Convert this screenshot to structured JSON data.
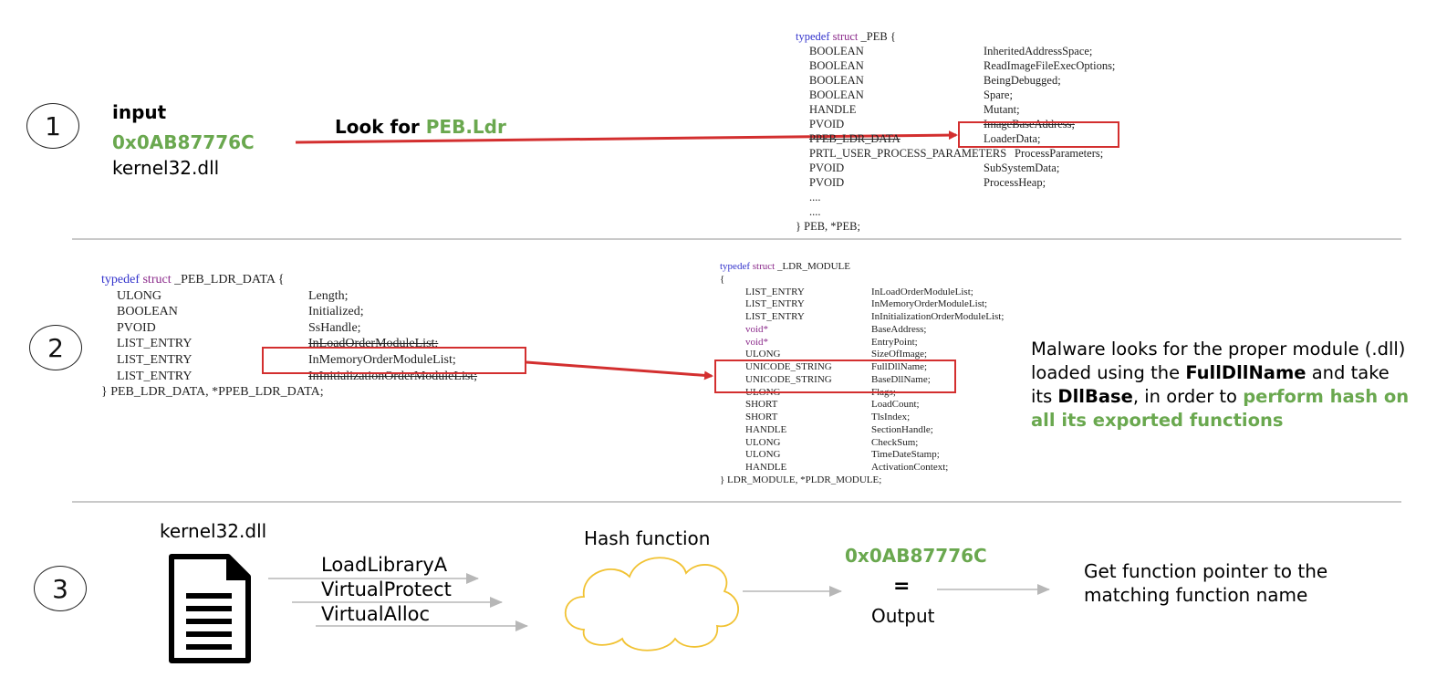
{
  "steps": [
    "1",
    "2",
    "3"
  ],
  "row1": {
    "input_label": "input",
    "input_hash": "0x0AB87776C",
    "input_dll": "kernel32.dll",
    "look_prefix": "Look for ",
    "look_target": "PEB.Ldr"
  },
  "peb": {
    "header": {
      "kw1": "typedef",
      "kw2": "struct",
      "name": "_PEB {"
    },
    "fields": [
      {
        "type": "BOOLEAN",
        "name": "InheritedAddressSpace;"
      },
      {
        "type": "BOOLEAN",
        "name": "ReadImageFileExecOptions;"
      },
      {
        "type": "BOOLEAN",
        "name": "BeingDebugged;"
      },
      {
        "type": "BOOLEAN",
        "name": "Spare;"
      },
      {
        "type": "HANDLE",
        "name": "Mutant;"
      },
      {
        "type": "PVOID",
        "name": "ImageBaseAddress;"
      },
      {
        "type": "PPEB_LDR_DATA",
        "name": "LoaderData;"
      },
      {
        "type": "PRTL_USER_PROCESS_PARAMETERS",
        "name": "ProcessParameters;"
      },
      {
        "type": "PVOID",
        "name": "SubSystemData;"
      },
      {
        "type": "PVOID",
        "name": "ProcessHeap;"
      },
      {
        "type": "....",
        "name": ""
      },
      {
        "type": "....",
        "name": ""
      }
    ],
    "footer": "} PEB, *PEB;"
  },
  "ldr_data": {
    "header": {
      "kw1": "typedef",
      "kw2": "struct",
      "name": "_PEB_LDR_DATA {"
    },
    "fields": [
      {
        "type": "ULONG",
        "name": "Length;"
      },
      {
        "type": "BOOLEAN",
        "name": "Initialized;"
      },
      {
        "type": "PVOID",
        "name": "SsHandle;"
      },
      {
        "type": "LIST_ENTRY",
        "name": "InLoadOrderModuleList;"
      },
      {
        "type": "LIST_ENTRY",
        "name": "InMemoryOrderModuleList;"
      },
      {
        "type": "LIST_ENTRY",
        "name": "InInitializationOrderModuleList;"
      }
    ],
    "footer": "} PEB_LDR_DATA, *PPEB_LDR_DATA;"
  },
  "ldr_module": {
    "header": {
      "kw1": "typedef",
      "kw2": "struct",
      "name": "_LDR_MODULE"
    },
    "brace_open": "{",
    "fields": [
      {
        "type": "LIST_ENTRY",
        "name": "InLoadOrderModuleList;"
      },
      {
        "type": "LIST_ENTRY",
        "name": "InMemoryOrderModuleList;"
      },
      {
        "type": "LIST_ENTRY",
        "name": "InInitializationOrderModuleList;"
      },
      {
        "type": "void*",
        "name": "BaseAddress;"
      },
      {
        "type": "void*",
        "name": "EntryPoint;"
      },
      {
        "type": "ULONG",
        "name": "SizeOfImage;"
      },
      {
        "type": "UNICODE_STRING",
        "name": "FullDllName;"
      },
      {
        "type": "UNICODE_STRING",
        "name": "BaseDllName;"
      },
      {
        "type": "ULONG",
        "name": "Flags;"
      },
      {
        "type": "SHORT",
        "name": "LoadCount;"
      },
      {
        "type": "SHORT",
        "name": "TlsIndex;"
      },
      {
        "type": "HANDLE",
        "name": "SectionHandle;"
      },
      {
        "type": "ULONG",
        "name": "CheckSum;"
      },
      {
        "type": "ULONG",
        "name": "TimeDateStamp;"
      },
      {
        "type": "HANDLE",
        "name": "ActivationContext;"
      }
    ],
    "footer": "} LDR_MODULE, *PLDR_MODULE;"
  },
  "row2": {
    "desc": {
      "t1": "Malware looks for the proper module (.dll) loaded using the ",
      "b1": "FullDllName",
      "t2": " and take its ",
      "b2": "DllBase",
      "t3": ", in order to ",
      "g1": "perform hash on all its exported functions"
    }
  },
  "row3": {
    "dll_label": "kernel32.dll",
    "apis": [
      "LoadLibraryA",
      "VirtualProtect",
      "VirtualAlloc"
    ],
    "hash_label": "Hash function",
    "out_hash": "0x0AB87776C",
    "equals": "=",
    "output_label": "Output",
    "result": "Get function pointer to the matching  function name"
  },
  "colors": {
    "green": "#6aa84f",
    "red": "#d32f2f",
    "cloud": "#f1c232",
    "arrow_grey": "#b7b7b7"
  }
}
